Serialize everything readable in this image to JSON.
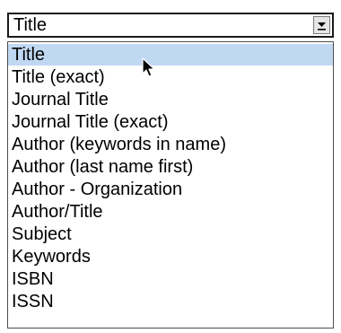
{
  "dropdown": {
    "selected_value": "Title",
    "options": [
      "Title",
      "Title (exact)",
      "Journal Title",
      "Journal Title (exact)",
      "Author (keywords in name)",
      "Author (last name first)",
      "Author - Organization",
      "Author/Title",
      "Subject",
      "Keywords",
      "ISBN",
      "ISSN"
    ],
    "highlighted_option": "Title",
    "highlight_color": "#c0d8f2",
    "arrow_icon": "chevron-down-icon"
  },
  "cursor": {
    "icon": "mouse-pointer-icon"
  }
}
